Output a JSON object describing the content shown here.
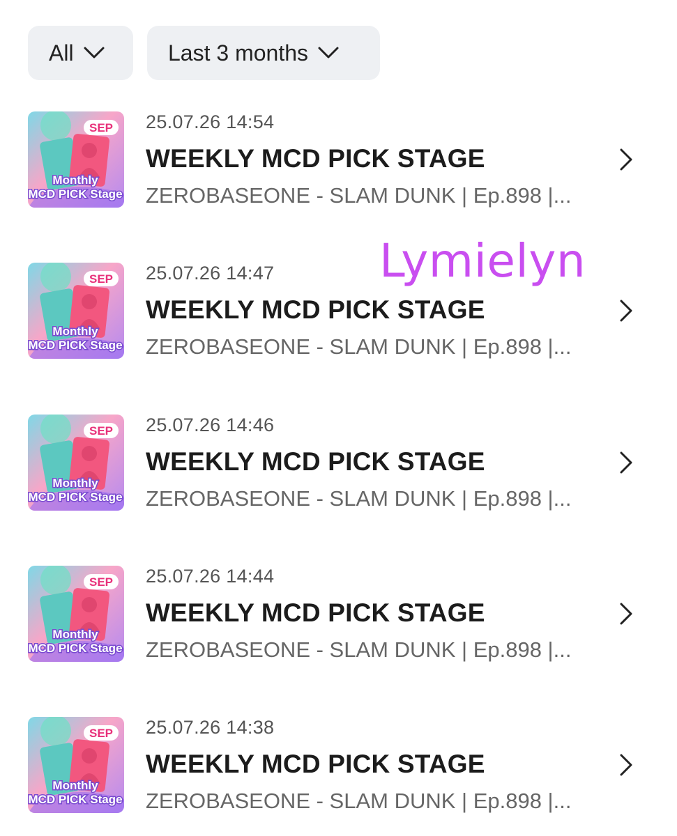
{
  "filters": {
    "type_label": "All",
    "period_label": "Last 3 months"
  },
  "thumbnail": {
    "badge": "SEP",
    "line1": "Monthly",
    "line2": "MCD PICK Stage"
  },
  "items": [
    {
      "date": "25.07.26 14:54",
      "title": "WEEKLY MCD PICK STAGE",
      "subtitle": "ZEROBASEONE - SLAM DUNK | Ep.898 |..."
    },
    {
      "date": "25.07.26 14:47",
      "title": "WEEKLY MCD PICK STAGE",
      "subtitle": "ZEROBASEONE - SLAM DUNK | Ep.898 |..."
    },
    {
      "date": "25.07.26 14:46",
      "title": "WEEKLY MCD PICK STAGE",
      "subtitle": "ZEROBASEONE - SLAM DUNK | Ep.898 |..."
    },
    {
      "date": "25.07.26 14:44",
      "title": "WEEKLY MCD PICK STAGE",
      "subtitle": "ZEROBASEONE - SLAM DUNK | Ep.898 |..."
    },
    {
      "date": "25.07.26 14:38",
      "title": "WEEKLY MCD PICK STAGE",
      "subtitle": "ZEROBASEONE - SLAM DUNK | Ep.898 |..."
    }
  ],
  "watermark": "Lymielyn",
  "colors": {
    "watermark": "#c94ef0",
    "badge": "#e8317a",
    "chip_bg": "#eef0f3"
  }
}
